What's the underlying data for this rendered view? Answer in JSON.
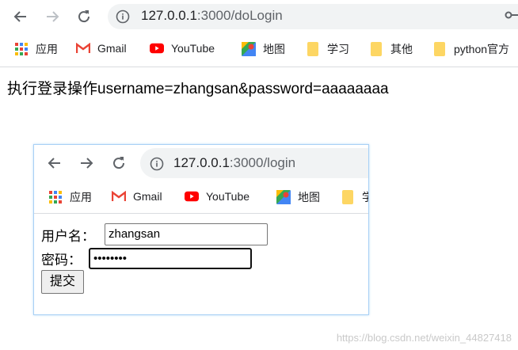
{
  "outer_browser": {
    "url_host": "127.0.0.1",
    "url_path": ":3000/doLogin",
    "bookmarks": [
      {
        "label": "应用",
        "icon": "apps-grid-icon"
      },
      {
        "label": "Gmail",
        "icon": "gmail-icon"
      },
      {
        "label": "YouTube",
        "icon": "youtube-icon"
      },
      {
        "label": "地图",
        "icon": "maps-icon"
      },
      {
        "label": "学习",
        "icon": "folder-icon"
      },
      {
        "label": "其他",
        "icon": "folder-icon"
      },
      {
        "label": "python官方",
        "icon": "folder-icon"
      }
    ]
  },
  "page": {
    "result_text": "执行登录操作username=zhangsan&password=aaaaaaaa"
  },
  "inner_browser": {
    "url_host": "127.0.0.1",
    "url_path": ":3000/login",
    "bookmarks": [
      {
        "label": "应用",
        "icon": "apps-grid-icon"
      },
      {
        "label": "Gmail",
        "icon": "gmail-icon"
      },
      {
        "label": "YouTube",
        "icon": "youtube-icon"
      },
      {
        "label": "地图",
        "icon": "maps-icon"
      },
      {
        "label": "学",
        "icon": "folder-icon"
      }
    ],
    "form": {
      "username_label": "用户名：",
      "username_value": "zhangsan",
      "password_label": "密码：",
      "password_value": "••••••••",
      "submit_label": "提交"
    }
  },
  "watermark": "https://blog.csdn.net/weixin_44827418",
  "colors": {
    "omnibox_bg": "#f1f3f4",
    "youtube_red": "#ff0000",
    "folder_yellow": "#fdd663",
    "inner_border": "#a8d0f5"
  }
}
